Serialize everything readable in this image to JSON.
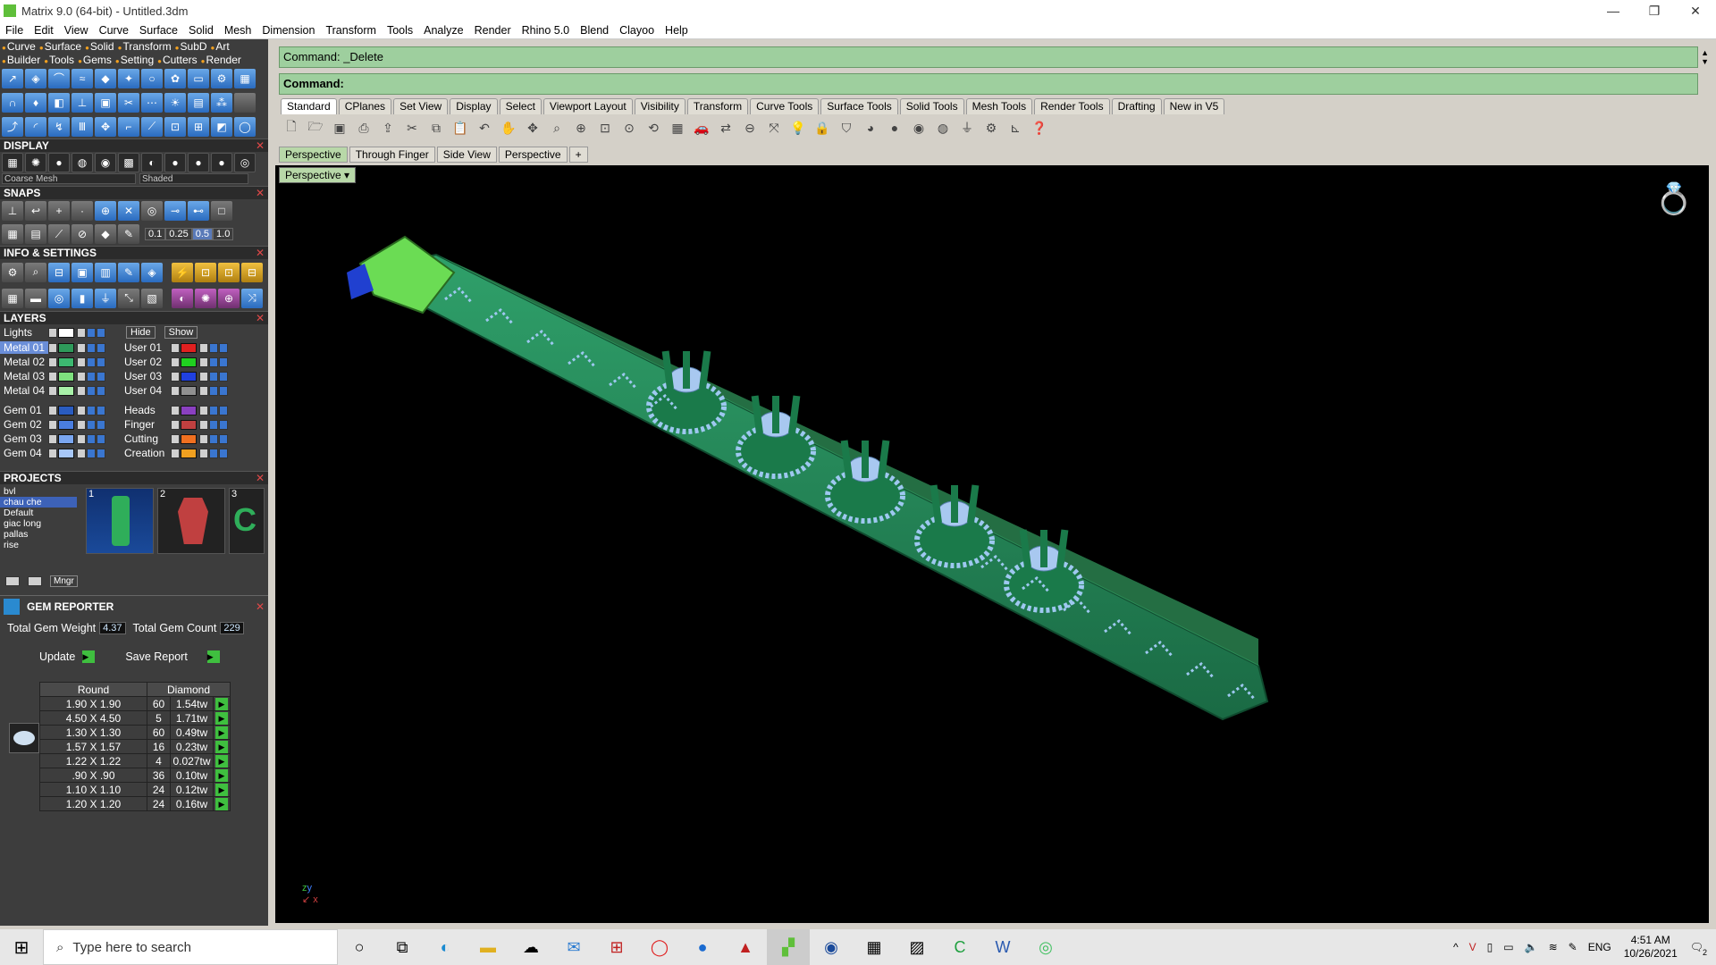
{
  "window": {
    "title": "Matrix 9.0 (64-bit) - Untitled.3dm",
    "buttons": [
      "—",
      "❐",
      "✕"
    ]
  },
  "menu": [
    "File",
    "Edit",
    "View",
    "Curve",
    "Surface",
    "Solid",
    "Mesh",
    "Dimension",
    "Transform",
    "Tools",
    "Analyze",
    "Render",
    "Rhino 5.0",
    "Blend",
    "Clayoo",
    "Help"
  ],
  "left_tabs_row1": [
    "Curve",
    "Surface",
    "Solid",
    "Transform",
    "SubD",
    "Art"
  ],
  "left_tabs_row2": [
    "Builder",
    "Tools",
    "Gems",
    "Setting",
    "Cutters",
    "Render"
  ],
  "display": {
    "title": "DISPLAY",
    "mesh_value": "Coarse Mesh",
    "shade_value": "Shaded"
  },
  "snaps": {
    "title": "SNAPS",
    "values": [
      "0.1",
      "0.25",
      "0.5",
      "1.0"
    ]
  },
  "info_settings": {
    "title": "INFO & SETTINGS"
  },
  "layers": {
    "title": "LAYERS",
    "lights": "Lights",
    "hide": "Hide",
    "show": "Show",
    "left": [
      {
        "name": "Metal 01",
        "color": "#2e9a5a",
        "selected": true
      },
      {
        "name": "Metal 02",
        "color": "#3cb870"
      },
      {
        "name": "Metal 03",
        "color": "#7ee07e"
      },
      {
        "name": "Metal 04",
        "color": "#a8f0a8"
      },
      {
        "name": "Gem 01",
        "color": "#2a5cc0"
      },
      {
        "name": "Gem 02",
        "color": "#4a7ee0"
      },
      {
        "name": "Gem 03",
        "color": "#7aa6f0"
      },
      {
        "name": "Gem 04",
        "color": "#a8c8f8"
      }
    ],
    "right": [
      {
        "name": "User 01",
        "color": "#e02020"
      },
      {
        "name": "User 02",
        "color": "#20d020"
      },
      {
        "name": "User 03",
        "color": "#2040e0"
      },
      {
        "name": "User 04",
        "color": "#909090"
      },
      {
        "name": "Heads",
        "color": "#8a40c0"
      },
      {
        "name": "Finger",
        "color": "#c04040"
      },
      {
        "name": "Cutting",
        "color": "#f07020"
      },
      {
        "name": "Creation",
        "color": "#f0a020"
      }
    ]
  },
  "projects": {
    "title": "PROJECTS",
    "list": [
      "bvl",
      "chau che",
      "Default",
      "giac long",
      "pallas",
      "rise"
    ],
    "selected": "chau che",
    "thumb_numbers": [
      "1",
      "2",
      "3"
    ],
    "mngr": "Mngr"
  },
  "gem_reporter": {
    "title": "GEM REPORTER",
    "weight_label": "Total Gem Weight",
    "weight_value": "4.37",
    "count_label": "Total Gem Count",
    "count_value": "229",
    "update": "Update",
    "save": "Save Report",
    "col1": "Round",
    "col2": "Diamond",
    "rows": [
      {
        "size": "1.90 X 1.90",
        "count": "60",
        "weight": "1.54tw"
      },
      {
        "size": "4.50 X 4.50",
        "count": "5",
        "weight": "1.71tw"
      },
      {
        "size": "1.30 X 1.30",
        "count": "60",
        "weight": "0.49tw"
      },
      {
        "size": "1.57 X 1.57",
        "count": "16",
        "weight": "0.23tw"
      },
      {
        "size": "1.22 X 1.22",
        "count": "4",
        "weight": "0.027tw"
      },
      {
        "size": ".90 X .90",
        "count": "36",
        "weight": "0.10tw"
      },
      {
        "size": "1.10 X 1.10",
        "count": "24",
        "weight": "0.12tw"
      },
      {
        "size": "1.20 X 1.20",
        "count": "24",
        "weight": "0.16tw"
      }
    ]
  },
  "command": {
    "history": "Command: _Delete",
    "prompt": "Command:"
  },
  "tool_tabs": [
    "Standard",
    "CPlanes",
    "Set View",
    "Display",
    "Select",
    "Viewport Layout",
    "Visibility",
    "Transform",
    "Curve Tools",
    "Surface Tools",
    "Solid Tools",
    "Mesh Tools",
    "Render Tools",
    "Drafting",
    "New in V5"
  ],
  "viewport_tabs": [
    "Perspective",
    "Through Finger",
    "Side View",
    "Perspective"
  ],
  "viewport": {
    "label": "Perspective"
  },
  "taskbar": {
    "search_placeholder": "Type here to search",
    "lang": "ENG",
    "time": "4:51 AM",
    "date": "10/26/2021",
    "notif": "2"
  }
}
